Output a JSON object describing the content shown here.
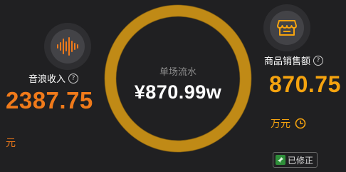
{
  "left_metric": {
    "icon": "sound-wave-icon",
    "label": "音浪收入",
    "help": "?",
    "value": "2387.75",
    "unit": "元"
  },
  "center_metric": {
    "title": "单场流水",
    "value": "¥870.99w",
    "ring_fill": 1.0
  },
  "right_metric": {
    "icon": "shop-icon",
    "label": "商品销售额",
    "help": "?",
    "value": "870.75",
    "unit": "万元"
  },
  "badge": {
    "icon": "pin-icon",
    "label": "已修正"
  },
  "colors": {
    "background": "#202022",
    "ring": "#c08a16",
    "left_accent": "#f07a1a",
    "right_accent": "#f5a30f"
  }
}
